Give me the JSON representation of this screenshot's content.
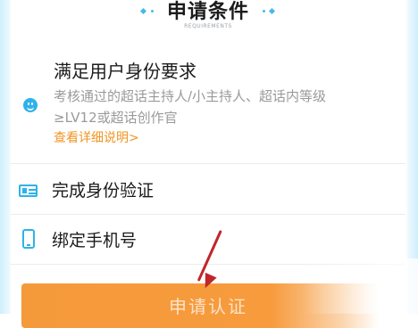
{
  "header": {
    "title": "申请条件",
    "subtitle": "REQUIREMENTS"
  },
  "requirements": [
    {
      "title": "满足用户身份要求",
      "description": "考核通过的超话主持人/小主持人、超话内等级≥LV12或超话创作官",
      "link": "查看详细说明>",
      "icon": "smiley-icon"
    },
    {
      "title": "完成身份验证",
      "icon": "id-card-icon"
    },
    {
      "title": "绑定手机号",
      "icon": "phone-icon"
    }
  ],
  "action": {
    "apply_label": "申请认证"
  },
  "colors": {
    "accent_blue": "#2fb2ea",
    "link_orange": "#f29423",
    "button_orange": "#f59a3b",
    "annotation_red": "#c0262a"
  }
}
